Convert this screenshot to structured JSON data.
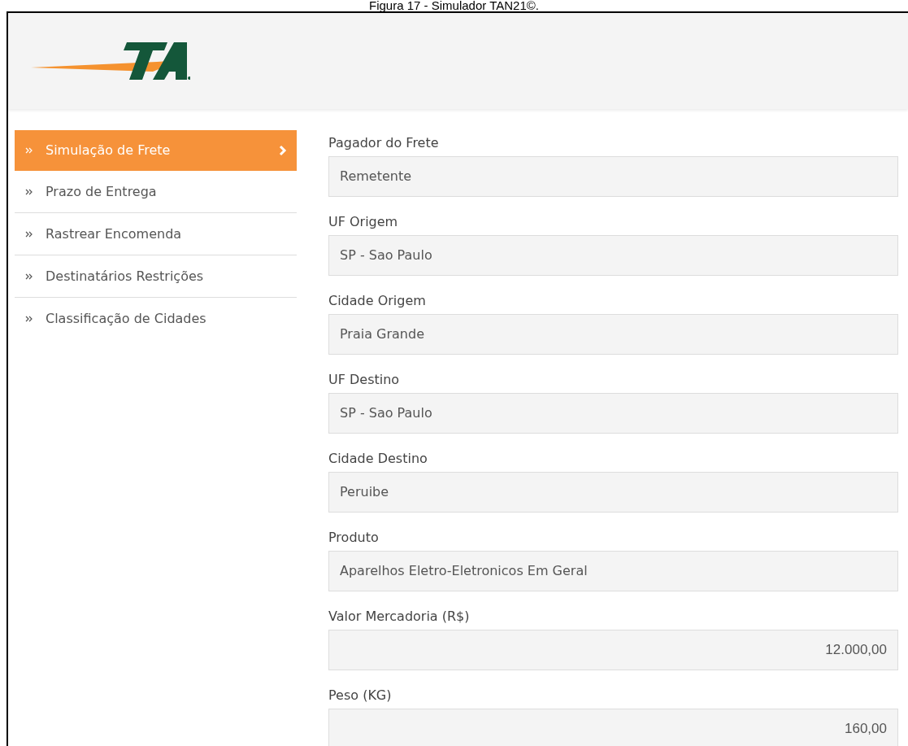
{
  "caption": "Figura 17 - Simulador TAN21©.",
  "sidebar": {
    "items": [
      {
        "label": "Simulação de Frete",
        "selected": true
      },
      {
        "label": "Prazo de Entrega",
        "selected": false
      },
      {
        "label": "Rastrear Encomenda",
        "selected": false
      },
      {
        "label": "Destinatários Restrições",
        "selected": false
      },
      {
        "label": "Classificação de Cidades",
        "selected": false
      }
    ]
  },
  "form": {
    "fields": [
      {
        "label": "Pagador do Frete",
        "value": "Remetente",
        "kind": "text"
      },
      {
        "label": "UF Origem",
        "value": "SP - Sao Paulo",
        "kind": "text"
      },
      {
        "label": "Cidade Origem",
        "value": "Praia Grande",
        "kind": "text"
      },
      {
        "label": "UF Destino",
        "value": "SP - Sao Paulo",
        "kind": "text"
      },
      {
        "label": "Cidade Destino",
        "value": "Peruibe",
        "kind": "text"
      },
      {
        "label": "Produto",
        "value": "Aparelhos Eletro-Eletronicos Em Geral",
        "kind": "text"
      },
      {
        "label": "Valor Mercadoria (R$)",
        "value": "12.000,00",
        "kind": "number"
      },
      {
        "label": "Peso (KG)",
        "value": "160,00",
        "kind": "number"
      }
    ]
  }
}
